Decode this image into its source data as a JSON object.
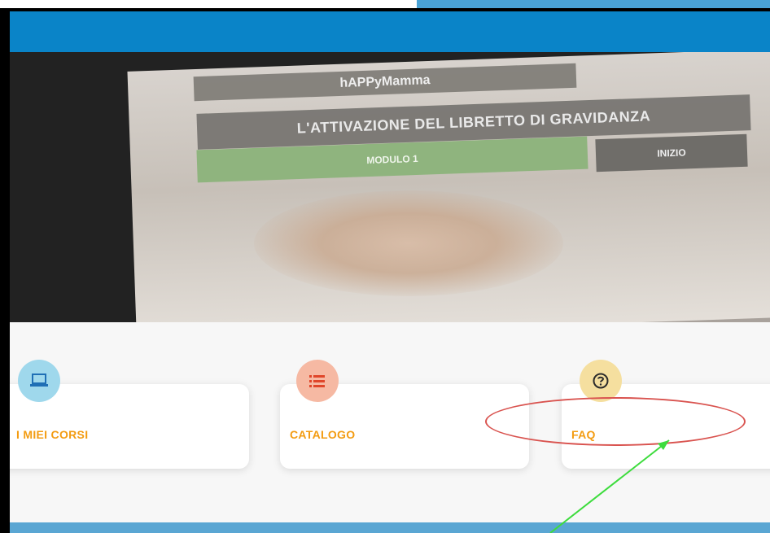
{
  "hero": {
    "brand": "hAPPyMamma",
    "course_title": "L'ATTIVAZIONE DEL LIBRETTO DI GRAVIDANZA",
    "module_button": "MODULO 1",
    "start_button": "INIZIO"
  },
  "cards": {
    "my_courses": {
      "label": "I MIEI CORSI",
      "icon": "laptop-icon"
    },
    "catalog": {
      "label": "CATALOGO",
      "icon": "list-icon"
    },
    "faq": {
      "label": "FAQ",
      "icon": "question-icon"
    }
  },
  "colors": {
    "header_blue": "#0a84c8",
    "label_orange": "#f39c12",
    "annotation_red": "#d9534f",
    "annotation_arrow": "#3ddc3d"
  }
}
